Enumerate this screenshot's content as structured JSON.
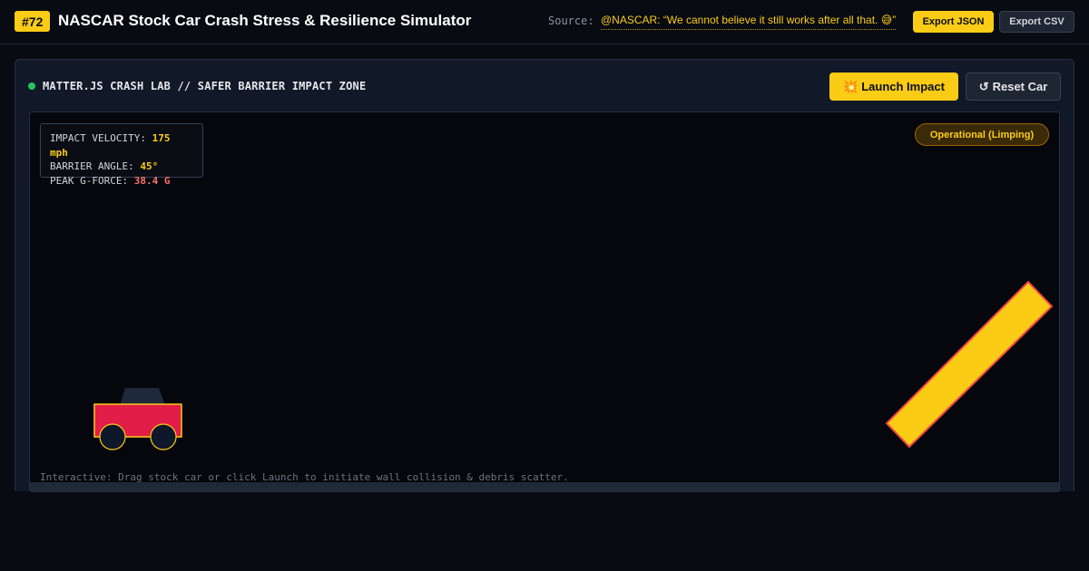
{
  "header": {
    "badge": "#72",
    "title": "NASCAR Stock Car Crash Stress & Resilience Simulator",
    "source_label": "Source:",
    "source_quote": "@NASCAR: “We cannot believe it still works after all that. 😅”",
    "export_json_label": "Export JSON",
    "export_csv_label": "Export CSV"
  },
  "panel": {
    "title": "MATTER.JS CRASH LAB // SAFER BARRIER IMPACT ZONE",
    "launch_label": "Launch Impact",
    "launch_icon": "💥",
    "reset_label": "Reset Car",
    "reset_icon": "↺"
  },
  "hud": {
    "velocity_label": "IMPACT VELOCITY:",
    "velocity_value": "175 mph",
    "angle_label": "BARRIER ANGLE:",
    "angle_value": "45°",
    "gforce_label": "PEAK G-FORCE:",
    "gforce_value": "38.4 G"
  },
  "status": {
    "label": "Operational (Limping)"
  },
  "hint": "Interactive: Drag stock car or click Launch to initiate wall collision & debris scatter.",
  "colors": {
    "accent": "#facc15",
    "car_body": "#e11d48",
    "barrier": "#facc15",
    "barrier_outline": "#ef4444",
    "live_dot": "#22c55e"
  }
}
